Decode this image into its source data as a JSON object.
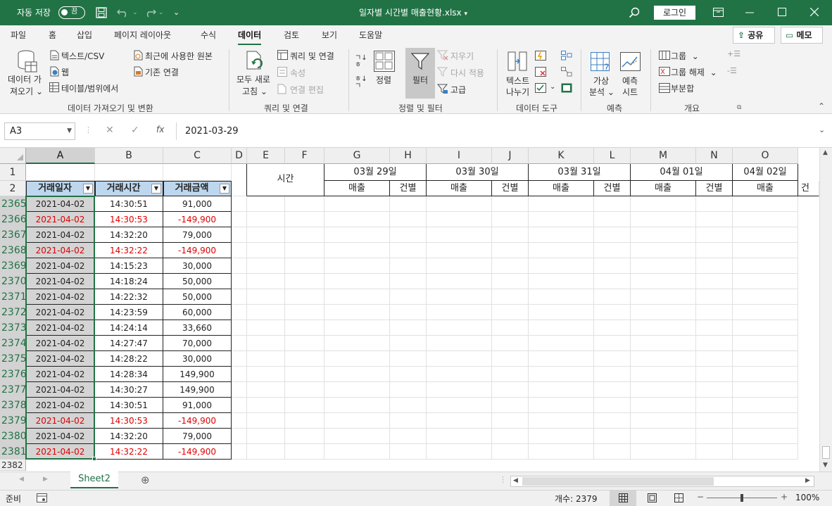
{
  "titlebar": {
    "autosave_label": "자동 저장",
    "autosave_state": "끔",
    "file_name": "일자별 시간별 매출현황.xlsx",
    "login_label": "로그인"
  },
  "tabs": [
    "파일",
    "홈",
    "삽입",
    "페이지 레이아웃",
    "수식",
    "데이터",
    "검토",
    "보기",
    "도움말"
  ],
  "active_tab": "데이터",
  "share_label": "공유",
  "memo_label": "메모",
  "ribbon": {
    "get_data_1": "데이터 가",
    "get_data_2": "져오기",
    "text_csv": "텍스트/CSV",
    "web": "웹",
    "table_range": "테이블/범위에서",
    "recent_sources": "최근에 사용한 원본",
    "existing_conn": "기존 연결",
    "group_get": "데이터 가져오기 및 변환",
    "refresh_1": "모두 새로",
    "refresh_2": "고침",
    "queries_conn": "쿼리 및 연결",
    "properties": "속성",
    "edit_links": "연결 편집",
    "group_queries": "쿼리 및 연결",
    "sort": "정렬",
    "filter": "필터",
    "clear": "지우기",
    "reapply": "다시 적용",
    "advanced": "고급",
    "group_sort": "정렬 및 필터",
    "text_to_col_1": "텍스트",
    "text_to_col_2": "나누기",
    "group_tools": "데이터 도구",
    "whatif_1": "가상",
    "whatif_2": "분석",
    "forecast_1": "예측",
    "forecast_2": "시트",
    "group_forecast": "예측",
    "group_btn": "그룹",
    "ungroup_btn": "그룹 해제",
    "subtotal": "부분합",
    "group_outline": "개요"
  },
  "formula": {
    "name_box": "A3",
    "fx": "fx",
    "value": "2021-03-29"
  },
  "columns": [
    "A",
    "B",
    "C",
    "D",
    "E",
    "F",
    "G",
    "H",
    "I",
    "J",
    "K",
    "L",
    "M",
    "N",
    "O"
  ],
  "header_row_numbers": [
    "1",
    "2"
  ],
  "table_headers": [
    "거래일자",
    "거래시간",
    "거래금액"
  ],
  "time_label": "시간",
  "date_headers": [
    "03월 29일",
    "03월 30일",
    "03월 31일",
    "04월 01일",
    "04월 02일"
  ],
  "sub_headers": {
    "sales": "매출",
    "count": "건별",
    "count_cut": "건"
  },
  "rows": [
    {
      "n": "2365",
      "date": "2021-04-02",
      "time": "14:30:51",
      "amount": "91,000",
      "neg": false
    },
    {
      "n": "2366",
      "date": "2021-04-02",
      "time": "14:30:53",
      "amount": "-149,900",
      "neg": true
    },
    {
      "n": "2367",
      "date": "2021-04-02",
      "time": "14:32:20",
      "amount": "79,000",
      "neg": false
    },
    {
      "n": "2368",
      "date": "2021-04-02",
      "time": "14:32:22",
      "amount": "-149,900",
      "neg": true
    },
    {
      "n": "2369",
      "date": "2021-04-02",
      "time": "14:15:23",
      "amount": "30,000",
      "neg": false
    },
    {
      "n": "2370",
      "date": "2021-04-02",
      "time": "14:18:24",
      "amount": "50,000",
      "neg": false
    },
    {
      "n": "2371",
      "date": "2021-04-02",
      "time": "14:22:32",
      "amount": "50,000",
      "neg": false
    },
    {
      "n": "2372",
      "date": "2021-04-02",
      "time": "14:23:59",
      "amount": "60,000",
      "neg": false
    },
    {
      "n": "2373",
      "date": "2021-04-02",
      "time": "14:24:14",
      "amount": "33,660",
      "neg": false
    },
    {
      "n": "2374",
      "date": "2021-04-02",
      "time": "14:27:47",
      "amount": "70,000",
      "neg": false
    },
    {
      "n": "2375",
      "date": "2021-04-02",
      "time": "14:28:22",
      "amount": "30,000",
      "neg": false
    },
    {
      "n": "2376",
      "date": "2021-04-02",
      "time": "14:28:34",
      "amount": "149,900",
      "neg": false
    },
    {
      "n": "2377",
      "date": "2021-04-02",
      "time": "14:30:27",
      "amount": "149,900",
      "neg": false
    },
    {
      "n": "2378",
      "date": "2021-04-02",
      "time": "14:30:51",
      "amount": "91,000",
      "neg": false
    },
    {
      "n": "2379",
      "date": "2021-04-02",
      "time": "14:30:53",
      "amount": "-149,900",
      "neg": true
    },
    {
      "n": "2380",
      "date": "2021-04-02",
      "time": "14:32:20",
      "amount": "79,000",
      "neg": false
    },
    {
      "n": "2381",
      "date": "2021-04-02",
      "time": "14:32:22",
      "amount": "-149,900",
      "neg": true
    }
  ],
  "partial_row": "2382",
  "sheet_tab": "Sheet2",
  "status": {
    "ready": "준비",
    "count": "개수: 2379",
    "zoom": "100%"
  },
  "colors": {
    "accent": "#217346",
    "header_fill": "#bdd7ee",
    "negative": "#e00000"
  }
}
